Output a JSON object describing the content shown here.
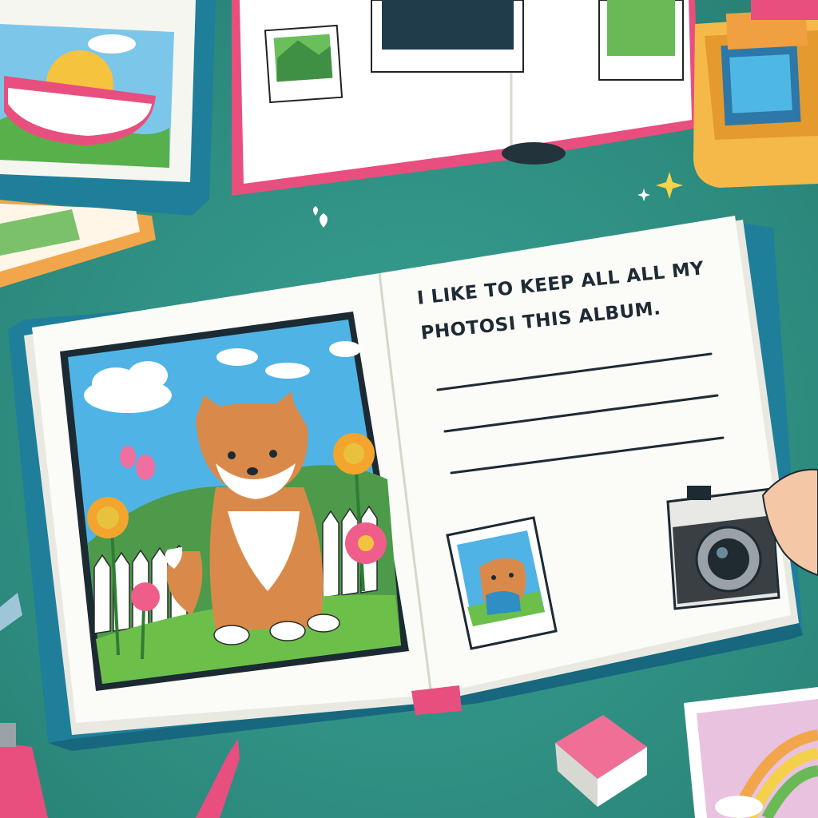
{
  "album_text": {
    "line1": "I LIKE TO KEEP ALL ALL MY",
    "line2": "PHOTOSI THIS ALBUM."
  },
  "colors": {
    "table": "#2f8f82",
    "album_cover": "#1f7f9a",
    "page": "#fbfbf7",
    "accent_pink": "#e8487a",
    "sky": "#4fb3e6",
    "grass": "#6cc04a",
    "fox": "#d98a4a"
  }
}
